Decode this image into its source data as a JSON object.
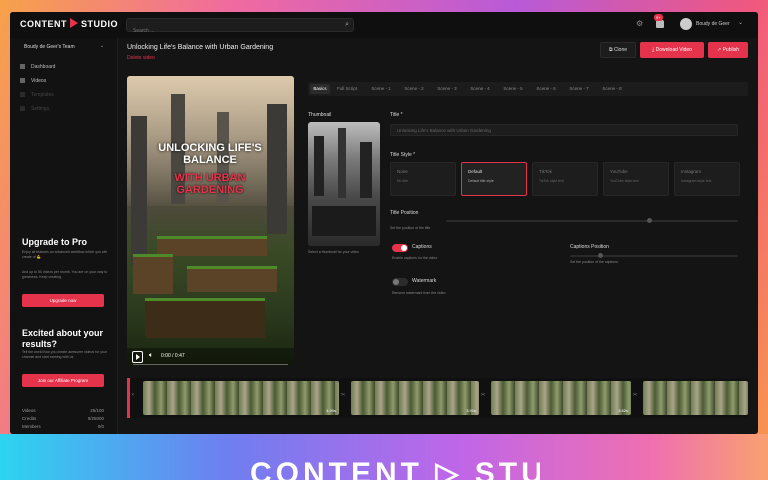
{
  "brand": {
    "name_part1": "CONTENT",
    "name_part2": "STUDIO"
  },
  "topbar": {
    "search_placeholder": "Search ...",
    "notification_count": "9+",
    "user_name": "Boudy de Geer"
  },
  "sidebar": {
    "team": "Boudy de Geer's Team",
    "nav": [
      {
        "label": "Dashboard",
        "icon": "grid-icon"
      },
      {
        "label": "Videos",
        "icon": "video-icon"
      },
      {
        "label": "Templates",
        "icon": "template-icon"
      },
      {
        "label": "Settings",
        "icon": "gear-icon"
      }
    ],
    "upgrade": {
      "title": "Upgrade to Pro",
      "text": "Enjoy all features an advanced workflow which you will create of 💪",
      "text2": "And up to 50 videos per month. You are on your way to greatness. Keep creating.",
      "button": "Upgrade now"
    },
    "affiliate": {
      "title": "Excited about your results?",
      "text": "Tell the world how you create awesome videos for your channel and start earning with us",
      "button": "Join our Affiliate Program"
    },
    "stats": [
      {
        "label": "Videos",
        "value": "26/100"
      },
      {
        "label": "Credits",
        "value": "0/25000"
      },
      {
        "label": "Members",
        "value": "0/0"
      }
    ]
  },
  "header": {
    "title": "Unlocking Life's Balance with Urban Gardening",
    "subtitle": "Delete video",
    "clone": "Clone",
    "download": "Download Video",
    "publish": "Publish"
  },
  "video": {
    "caption_line1": "UNLOCKING LIFE'S BALANCE",
    "caption_line2": "WITH URBAN GARDENING",
    "time": "0:00 / 0:47",
    "progress": 0
  },
  "tabs": [
    "Basics",
    "Full Script",
    "Scene - 1",
    "Scene - 2",
    "Scene - 3",
    "Scene - 4",
    "Scene - 5",
    "Scene - 6",
    "Scene - 7",
    "Scene - 8"
  ],
  "basics": {
    "thumbnail_label": "Thumbnail",
    "thumbnail_hint": "Select a thumbnail for your video",
    "title_label": "Title *",
    "title_value": "Unlocking Life's Balance with Urban Gardening",
    "title_style_label": "Title Style *",
    "styles": [
      {
        "name": "None",
        "desc": "No title"
      },
      {
        "name": "Default",
        "desc": "Default title style"
      },
      {
        "name": "TikTok",
        "desc": "TikTok style text"
      },
      {
        "name": "YouTube",
        "desc": "YouTube style text"
      },
      {
        "name": "Instagram",
        "desc": "Instagram style text"
      }
    ],
    "title_position_label": "Title Position",
    "title_position_hint": "Set the position of the title",
    "captions_label": "Captions",
    "captions_hint": "Enable captions for the video",
    "captions_on": true,
    "captions_position_label": "Captions Position",
    "captions_position_hint": "Set the position of the captions",
    "watermark_label": "Watermark",
    "watermark_hint": "Remove watermark from the video",
    "watermark_on": false
  },
  "timeline": {
    "clips": [
      {
        "duration": "4.90s"
      },
      {
        "duration": "3.91s"
      },
      {
        "duration": "3.82s"
      },
      {
        "duration": ""
      }
    ]
  },
  "colors": {
    "accent": "#e5334b",
    "panel": "#141414"
  }
}
